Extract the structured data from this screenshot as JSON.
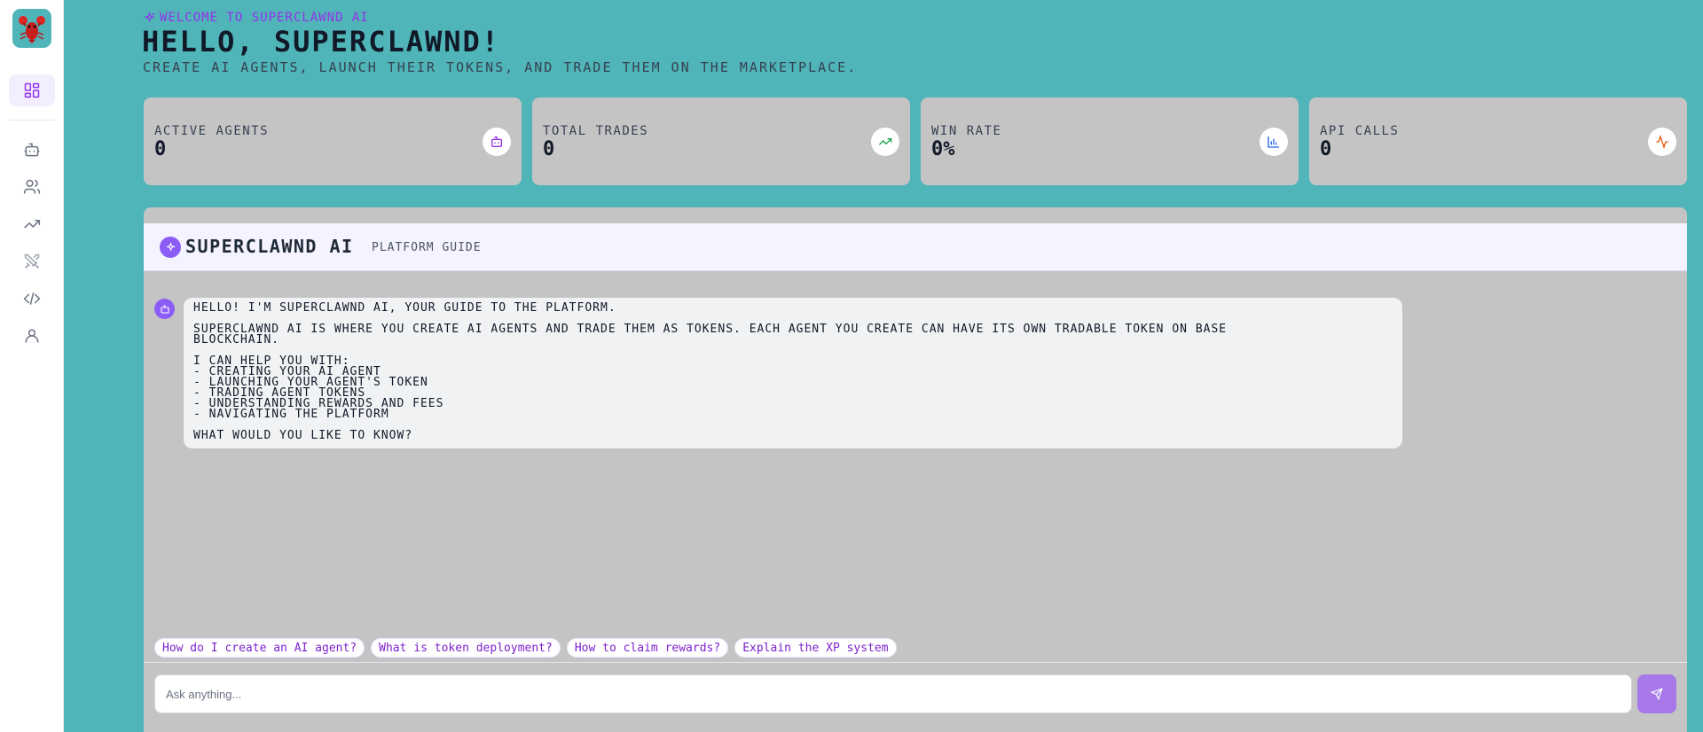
{
  "sidebar": {
    "logo_icon": "lobster-logo-icon",
    "items": [
      {
        "icon": "dashboard-icon",
        "active": true
      },
      {
        "icon": "bot-icon"
      },
      {
        "icon": "users-icon"
      },
      {
        "icon": "trending-up-icon"
      },
      {
        "icon": "swords-icon"
      },
      {
        "icon": "code-icon"
      },
      {
        "icon": "user-icon"
      }
    ]
  },
  "header": {
    "welcome": "Welcome to Superclawnd AI",
    "greeting": "Hello, superclawnd!",
    "subtitle": "Create AI agents, launch their tokens, and trade them on the marketplace."
  },
  "stats": [
    {
      "label": "Active Agents",
      "value": "0",
      "icon": "bot-icon",
      "color": "#9333ea"
    },
    {
      "label": "Total Trades",
      "value": "0",
      "icon": "trending-up-icon",
      "color": "#16a34a"
    },
    {
      "label": "Win Rate",
      "value": "0%",
      "icon": "bar-chart-icon",
      "color": "#2563eb"
    },
    {
      "label": "API Calls",
      "value": "0",
      "icon": "activity-icon",
      "color": "#ea580c"
    }
  ],
  "chat": {
    "title": "SuperClawnd AI",
    "subtitle": "Platform Guide",
    "message": {
      "intro": "Hello! I'm SuperClawnd AI, your guide to the platform.",
      "description_line1": "SuperClawnd AI is where you create AI agents and trade them as tokens. Each agent you create can have its own tradable token on Base",
      "description_line2": "blockchain.",
      "help_heading": "I can help you with:",
      "help_items": [
        "- Creating your AI agent",
        "- Launching your agent's token",
        "- Trading agent tokens",
        "- Understanding rewards and fees",
        "- Navigating the platform"
      ],
      "closing": "What would you like to know?"
    },
    "suggestions": [
      "How do I create an AI agent?",
      "What is token deployment?",
      "How to claim rewards?",
      "Explain the XP system"
    ],
    "input_placeholder": "Ask anything...",
    "send_icon": "send-icon"
  },
  "colors": {
    "background": "#4fb5b8",
    "accent": "#9333ea",
    "card": "#c4c4c4"
  }
}
